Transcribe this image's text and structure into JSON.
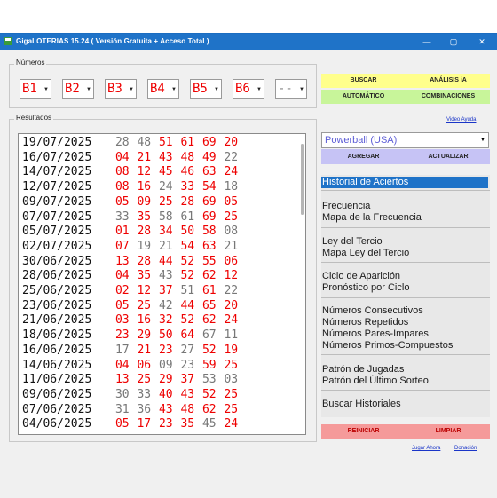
{
  "window": {
    "title": "GigaLOTERIAS 15.24  ( Versión Gratuita + Acceso Total )",
    "minimize": "—",
    "maximize": "▢",
    "close": "✕"
  },
  "numeros": {
    "label": "Números",
    "boxes": [
      "B1",
      "B2",
      "B3",
      "B4",
      "B5",
      "B6",
      "--"
    ]
  },
  "resultados": {
    "label": "Resultados",
    "rows": [
      {
        "date": "19/07/2025",
        "nums": [
          "28",
          "48",
          "51",
          "61",
          "69",
          "20"
        ],
        "red": [
          false,
          false,
          true,
          true,
          true,
          true
        ]
      },
      {
        "date": "16/07/2025",
        "nums": [
          "04",
          "21",
          "43",
          "48",
          "49",
          "22"
        ],
        "red": [
          true,
          true,
          true,
          true,
          true,
          false
        ]
      },
      {
        "date": "14/07/2025",
        "nums": [
          "08",
          "12",
          "45",
          "46",
          "63",
          "24"
        ],
        "red": [
          true,
          true,
          true,
          true,
          true,
          true
        ]
      },
      {
        "date": "12/07/2025",
        "nums": [
          "08",
          "16",
          "24",
          "33",
          "54",
          "18"
        ],
        "red": [
          true,
          true,
          false,
          true,
          true,
          false
        ]
      },
      {
        "date": "09/07/2025",
        "nums": [
          "05",
          "09",
          "25",
          "28",
          "69",
          "05"
        ],
        "red": [
          true,
          true,
          true,
          true,
          true,
          true
        ]
      },
      {
        "date": "07/07/2025",
        "nums": [
          "33",
          "35",
          "58",
          "61",
          "69",
          "25"
        ],
        "red": [
          false,
          true,
          false,
          false,
          true,
          true
        ]
      },
      {
        "date": "05/07/2025",
        "nums": [
          "01",
          "28",
          "34",
          "50",
          "58",
          "08"
        ],
        "red": [
          true,
          true,
          true,
          true,
          true,
          false
        ]
      },
      {
        "date": "02/07/2025",
        "nums": [
          "07",
          "19",
          "21",
          "54",
          "63",
          "21"
        ],
        "red": [
          true,
          false,
          false,
          true,
          true,
          false
        ]
      },
      {
        "date": "30/06/2025",
        "nums": [
          "13",
          "28",
          "44",
          "52",
          "55",
          "06"
        ],
        "red": [
          true,
          true,
          true,
          true,
          true,
          true
        ]
      },
      {
        "date": "28/06/2025",
        "nums": [
          "04",
          "35",
          "43",
          "52",
          "62",
          "12"
        ],
        "red": [
          true,
          true,
          false,
          true,
          true,
          true
        ]
      },
      {
        "date": "25/06/2025",
        "nums": [
          "02",
          "12",
          "37",
          "51",
          "61",
          "22"
        ],
        "red": [
          true,
          true,
          true,
          false,
          true,
          false
        ]
      },
      {
        "date": "23/06/2025",
        "nums": [
          "05",
          "25",
          "42",
          "44",
          "65",
          "20"
        ],
        "red": [
          true,
          true,
          false,
          true,
          true,
          true
        ]
      },
      {
        "date": "21/06/2025",
        "nums": [
          "03",
          "16",
          "32",
          "52",
          "62",
          "24"
        ],
        "red": [
          true,
          true,
          true,
          true,
          true,
          true
        ]
      },
      {
        "date": "18/06/2025",
        "nums": [
          "23",
          "29",
          "50",
          "64",
          "67",
          "11"
        ],
        "red": [
          true,
          true,
          true,
          true,
          false,
          false
        ]
      },
      {
        "date": "16/06/2025",
        "nums": [
          "17",
          "21",
          "23",
          "27",
          "52",
          "19"
        ],
        "red": [
          false,
          true,
          true,
          false,
          true,
          true
        ]
      },
      {
        "date": "14/06/2025",
        "nums": [
          "04",
          "06",
          "09",
          "23",
          "59",
          "25"
        ],
        "red": [
          true,
          true,
          false,
          false,
          true,
          true
        ]
      },
      {
        "date": "11/06/2025",
        "nums": [
          "13",
          "25",
          "29",
          "37",
          "53",
          "03"
        ],
        "red": [
          true,
          true,
          true,
          true,
          false,
          false
        ]
      },
      {
        "date": "09/06/2025",
        "nums": [
          "30",
          "33",
          "40",
          "43",
          "52",
          "25"
        ],
        "red": [
          false,
          false,
          true,
          true,
          true,
          true
        ]
      },
      {
        "date": "07/06/2025",
        "nums": [
          "31",
          "36",
          "43",
          "48",
          "62",
          "25"
        ],
        "red": [
          false,
          false,
          true,
          true,
          true,
          true
        ]
      },
      {
        "date": "04/06/2025",
        "nums": [
          "05",
          "17",
          "23",
          "35",
          "45",
          "24"
        ],
        "red": [
          true,
          true,
          true,
          true,
          false,
          true
        ]
      }
    ]
  },
  "buttons": {
    "buscar": "BUSCAR",
    "analisis": "ANÁLISIS iA",
    "automatico": "AUTOMÁTICO",
    "combinaciones": "COMBINACIONES",
    "agregar": "AGREGAR",
    "actualizar": "ACTUALIZAR",
    "reiniciar": "REINICIAR",
    "limpiar": "LIMPIAR"
  },
  "links": {
    "video_ayuda": "Video Ayuda",
    "jugar_ahora": "Jugar Ahora",
    "donacion": "Donación"
  },
  "lottery_select": "Powerball (USA)",
  "menu": {
    "historial": "Historial de Aciertos",
    "frecuencia": "Frecuencia",
    "mapa_frecuencia": "Mapa de la Frecuencia",
    "ley_tercio": "Ley del Tercio",
    "mapa_tercio": "Mapa Ley del Tercio",
    "ciclo": "Ciclo de Aparición",
    "pronostico": "Pronóstico por Ciclo",
    "consecutivos": "Números Consecutivos",
    "repetidos": "Números Repetidos",
    "pares_impares": "Números Pares-Impares",
    "primos": "Números Primos-Compuestos",
    "patron_jugadas": "Patrón de Jugadas",
    "patron_ultimo": "Patrón del Último Sorteo",
    "buscar_historiales": "Buscar Historiales"
  },
  "colors": {
    "titlebar": "#1f73c8",
    "number_red": "#ee0000",
    "number_gray": "#777777"
  }
}
